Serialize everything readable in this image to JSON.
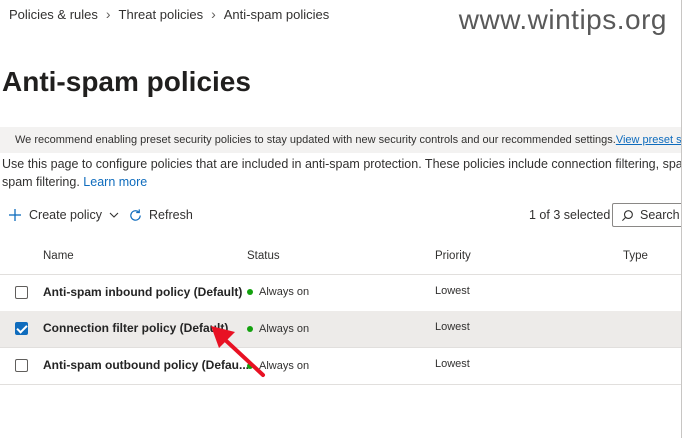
{
  "breadcrumb": [
    "Policies & rules",
    "Threat policies",
    "Anti-spam policies"
  ],
  "watermark": "www.wintips.org",
  "page_title": "Anti-spam policies",
  "banner": {
    "text": "We recommend enabling preset security policies to stay updated with new security controls and our recommended settings.",
    "link": "View preset security"
  },
  "description": {
    "line1": "Use this page to configure policies that are included in anti-spam protection. These policies include connection filtering, spam filt",
    "line2": "spam filtering.",
    "link": "Learn more"
  },
  "toolbar": {
    "create_label": "Create policy",
    "refresh_label": "Refresh",
    "selection_count": "1 of 3 selected",
    "search_label": "Search"
  },
  "table": {
    "columns": [
      "Name",
      "Status",
      "Priority",
      "Type"
    ],
    "rows": [
      {
        "name": "Anti-spam inbound policy (Default)",
        "status": "Always on",
        "priority": "Lowest",
        "checked": false
      },
      {
        "name": "Connection filter policy (Default)",
        "status": "Always on",
        "priority": "Lowest",
        "checked": true
      },
      {
        "name": "Anti-spam outbound policy (Defau...",
        "status": "Always on",
        "priority": "Lowest",
        "checked": false
      }
    ]
  },
  "colors": {
    "accent": "#0f6cbd",
    "status_green": "#13a10e",
    "annotation_red": "#e81123"
  }
}
